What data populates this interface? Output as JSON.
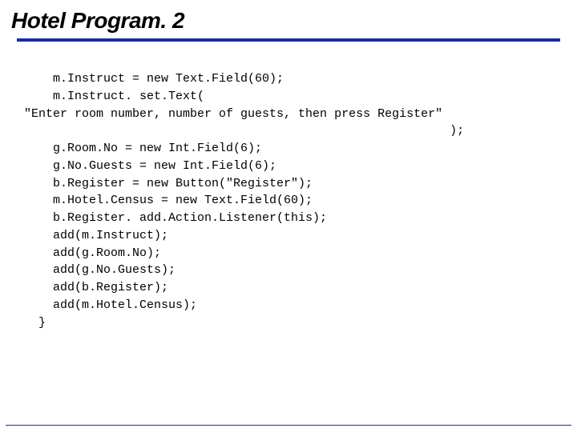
{
  "slide": {
    "title": "Hotel Program. 2",
    "code": "    m.Instruct = new Text.Field(60);\n    m.Instruct. set.Text(\n\"Enter room number, number of guests, then press Register\"\n                                                           );\n    g.Room.No = new Int.Field(6);\n    g.No.Guests = new Int.Field(6);\n    b.Register = new Button(\"Register\");\n    m.Hotel.Census = new Text.Field(60);\n    b.Register. add.Action.Listener(this);\n    add(m.Instruct);\n    add(g.Room.No);\n    add(g.No.Guests);\n    add(b.Register);\n    add(m.Hotel.Census);\n  }"
  }
}
